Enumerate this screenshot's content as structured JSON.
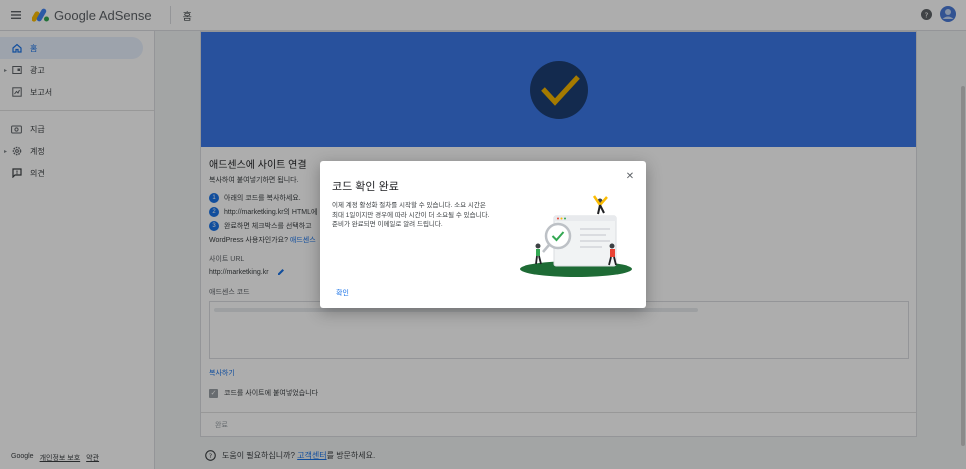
{
  "topbar": {
    "brand_google": "Google",
    "brand_product": "AdSense",
    "page_title": "홈"
  },
  "sidebar": {
    "items": [
      {
        "label": "홈",
        "icon": "home-icon",
        "active": true
      },
      {
        "label": "광고",
        "icon": "ads-icon",
        "has_caret": true
      },
      {
        "label": "보고서",
        "icon": "report-icon"
      },
      {
        "label": "지급",
        "icon": "payments-icon"
      },
      {
        "label": "계정",
        "icon": "gear-icon",
        "has_caret": true
      },
      {
        "label": "의견",
        "icon": "feedback-icon"
      }
    ],
    "footer": {
      "brand": "Google",
      "privacy": "개인정보 보호",
      "terms": "약관"
    }
  },
  "card": {
    "title": "애드센스에 사이트 연결",
    "subtitle": "복사하여 붙여넣기하면 됩니다.",
    "steps": [
      {
        "num": "1",
        "text": "아래의 코드를 복사하세요."
      },
      {
        "num": "2",
        "text": "http://marketking.kr의 HTML에"
      },
      {
        "num": "3",
        "text": "완료하면 체크박스를 선택하고"
      }
    ],
    "wordpress_text": "WordPress 사용자인가요?",
    "wordpress_link": "애드센스",
    "site_url_label": "사이트 URL",
    "site_url_value": "http://marketking.kr",
    "code_label": "애드센스 코드",
    "copy_link": "복사하기",
    "checkbox_label": "코드를 사이트에 붙여넣었습니다",
    "done_button": "완료"
  },
  "help": {
    "prefix": "도움이 필요하십니까?",
    "link": "고객센터",
    "suffix": "를 방문하세요."
  },
  "dialog": {
    "title": "코드 확인 완료",
    "lines": [
      "이제 계정 활성화 절차를 시작할 수 있습니다. 소요 시간은",
      "최대 1일이지만 경우에 따라 시간이 더 소요될 수 있습니다.",
      "준비가 완료되면 이메일로 알려 드립니다."
    ],
    "confirm_button": "확인"
  },
  "colors": {
    "accent": "#1a73e8",
    "hero": "#3b78e7",
    "check_circle": "#1d3f73",
    "check_mark": "#f4b400"
  }
}
